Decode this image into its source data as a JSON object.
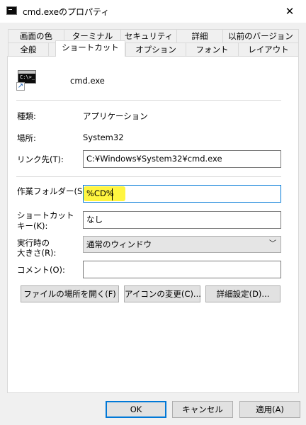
{
  "window": {
    "title": "cmd.exeのプロパティ",
    "close_glyph": "✕"
  },
  "tabs_back": [
    "画面の色",
    "ターミナル",
    "セキュリティ",
    "詳細",
    "以前のバージョン"
  ],
  "tabs_front": [
    "全般",
    "ショートカット",
    "オプション",
    "フォント",
    "レイアウト"
  ],
  "selected_tab": "ショートカット",
  "shortcut": {
    "name": "cmd.exe",
    "icon_prompt": "C:\\>_",
    "type_label": "種類:",
    "type_value": "アプリケーション",
    "location_label": "場所:",
    "location_value": "System32",
    "target_label": "リンク先(T):",
    "target_value": "C:¥Windows¥System32¥cmd.exe",
    "workdir_label": "作業フォルダー(S):",
    "workdir_value": "%CD%",
    "hotkey_label_1": "ショートカット",
    "hotkey_label_2": "キー(K):",
    "hotkey_value": "なし",
    "run_label_1": "実行時の",
    "run_label_2": "大きさ(R):",
    "run_value": "通常のウィンドウ",
    "comment_label": "コメント(O):",
    "comment_value": ""
  },
  "actions": {
    "open_location": "ファイルの場所を開く(F)",
    "change_icon": "アイコンの変更(C)...",
    "advanced": "詳細設定(D)..."
  },
  "dialog_buttons": {
    "ok": "OK",
    "cancel": "キャンセル",
    "apply": "適用(A)"
  },
  "colors": {
    "highlight": "#fff200",
    "focus_border": "#0078d7"
  }
}
